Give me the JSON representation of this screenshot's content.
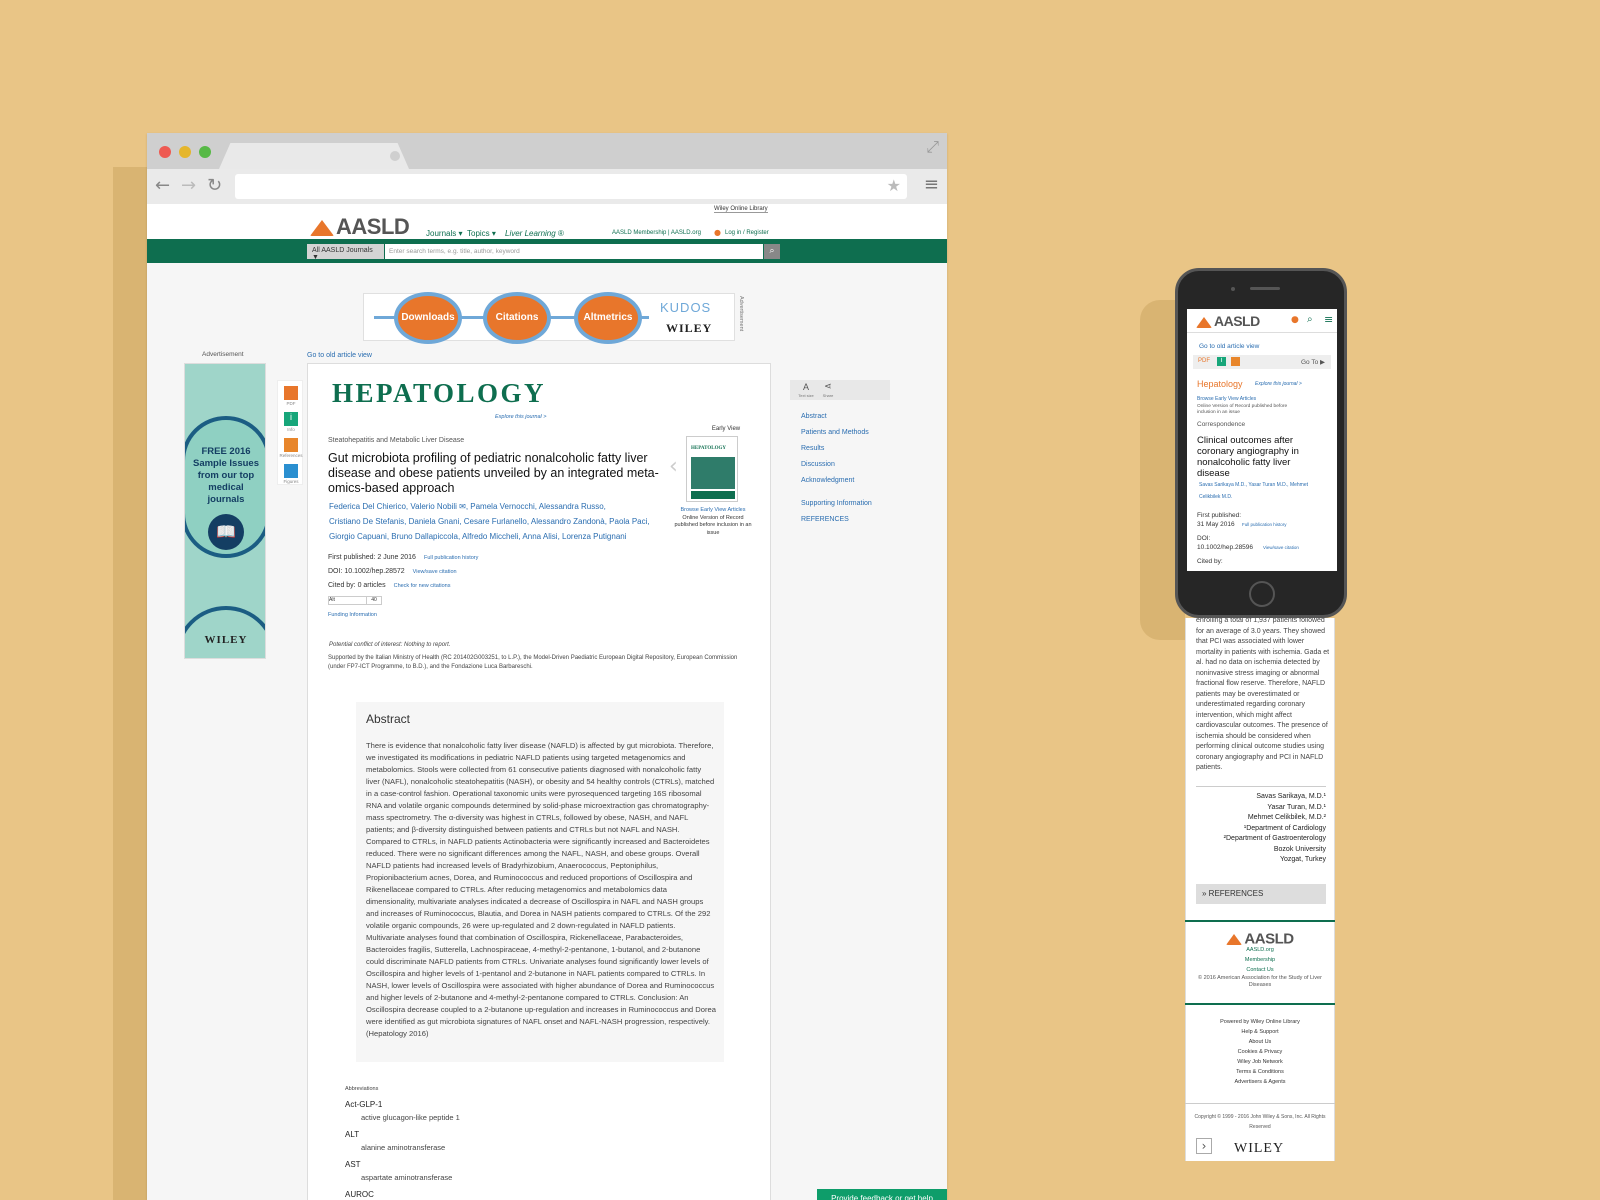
{
  "browser": {
    "url": ""
  },
  "site": {
    "logo": "AASLD",
    "nav": {
      "journals": "Journals ▾",
      "topics": "Topics ▾",
      "liver_learning": "Liver Learning ®"
    },
    "wiley_online_library": "Wiley Online Library",
    "top_links": "AASLD Membership | AASLD.org",
    "login": "Log in / Register",
    "select": "All AASLD Journals ▼",
    "search_placeholder": "Enter search terms, e.g. title, author, keyword"
  },
  "banner": {
    "downloads": "Downloads",
    "citations": "Citations",
    "altmetrics": "Altmetrics",
    "kudos": "KUDOS",
    "wiley": "WILEY",
    "advert": "Advertisement"
  },
  "left_ad": {
    "label": "Advertisement",
    "text": "FREE 2016 Sample Issues from our top medical journals",
    "wiley": "WILEY"
  },
  "article": {
    "old_view": "Go to old article view",
    "journal": "HEPATOLOGY",
    "explore": "Explore this journal >",
    "section": "Steatohepatitis and Metabolic Liver Disease",
    "title": "Gut microbiota profiling of pediatric nonalcoholic fatty liver disease and obese patients unveiled by an integrated meta-omics-based approach",
    "authors_1": "Federica Del Chierico,  Valerio Nobili ✉,  Pamela Vernocchi,  Alessandra Russo,",
    "authors_2": "Cristiano De Stefanis,  Daniela Gnani,  Cesare Furlanello,  Alessandro Zandonà,  Paola Paci,",
    "authors_3": "Giorgio Capuani,  Bruno Dallapiccola,  Alfredo Miccheli,  Anna Alisi,  Lorenza Putignani",
    "first_published": "First published:   2 June 2016",
    "first_published_link": "Full publication history",
    "doi": "DOI:   10.1002/hep.28572",
    "doi_link": "View/save citation",
    "cited_by": "Cited by:   0 articles",
    "cited_link": "Check for new citations",
    "altmetric": "Alt",
    "altmetric_score": "40",
    "funding": "Funding Information",
    "conflict": "Potential conflict of interest: Nothing to report.",
    "support": "Supported by the Italian Ministry of Health (RC 201402G003251, to L.P.), the Model-Driven Paediatric European Digital Repository, European Commission (under FP7-ICT Programme, to B.D.), and the Fondazione Luca Barbareschi.",
    "early_view": "Early View",
    "cover_title": "HEPATOLOGY",
    "browse_ev": "Browse Early View Articles",
    "ev_note": "Online Version of Record published before inclusion in an issue",
    "tools": {
      "pdf": "PDF",
      "info": "Info",
      "references": "References",
      "figures": "Figures"
    }
  },
  "abstract": {
    "heading": "Abstract",
    "text": "There is evidence that nonalcoholic fatty liver disease (NAFLD) is affected by gut microbiota. Therefore, we investigated its modifications in pediatric NAFLD patients using targeted metagenomics and metabolomics. Stools were collected from 61 consecutive patients diagnosed with nonalcoholic fatty liver (NAFL), nonalcoholic steatohepatitis (NASH), or obesity and 54 healthy controls (CTRLs), matched in a case-control fashion. Operational taxonomic units were pyrosequenced targeting 16S ribosomal RNA and volatile organic compounds determined by solid-phase microextraction gas chromatography-mass spectrometry. The α-diversity was highest in CTRLs, followed by obese, NASH, and NAFL patients; and β-diversity distinguished between patients and CTRLs but not NAFL and NASH. Compared to CTRLs, in NAFLD patients Actinobacteria were significantly increased and Bacteroidetes reduced. There were no significant differences among the NAFL, NASH, and obese groups. Overall NAFLD patients had increased levels of Bradyrhizobium, Anaerococcus, Peptoniphilus, Propionibacterium acnes, Dorea, and Ruminococcus and reduced proportions of Oscillospira and Rikenellaceae compared to CTRLs. After reducing metagenomics and metabolomics data dimensionality, multivariate analyses indicated a decrease of Oscillospira in NAFL and NASH groups and increases of Ruminococcus, Blautia, and Dorea in NASH patients compared to CTRLs. Of the 292 volatile organic compounds, 26 were up-regulated and 2 down-regulated in NAFLD patients. Multivariate analyses found that combination of Oscillospira, Rickenellaceae, Parabacteroides, Bacteroides fragilis, Sutterella, Lachnospiraceae, 4-methyl-2-pentanone, 1-butanol, and 2-butanone could discriminate NAFLD patients from CTRLs. Univariate analyses found significantly lower levels of Oscillospira and higher levels of 1-pentanol and 2-butanone in NAFL patients compared to CTRLs. In NASH, lower levels of Oscillospira were associated with higher abundance of Dorea and Ruminococcus and higher levels of 2-butanone and 4-methyl-2-pentanone compared to CTRLs. Conclusion: An Oscillospira decrease coupled to a 2-butanone up-regulation and increases in Ruminococcus and Dorea were identified as gut microbiota signatures of NAFL onset and NAFL-NASH progression, respectively. (Hepatology 2016)"
  },
  "abbreviations": {
    "label": "Abbreviations",
    "items": [
      {
        "term": "Act-GLP-1",
        "def": "active glucagon-like peptide 1"
      },
      {
        "term": "ALT",
        "def": "alanine aminotransferase"
      },
      {
        "term": "AST",
        "def": "aspartate aminotransferase"
      },
      {
        "term": "AUROC",
        "def": ""
      }
    ]
  },
  "right_tools": {
    "text_size": "Text size",
    "share": "Share"
  },
  "toc": [
    "Abstract",
    "Patients and Methods",
    "Results",
    "Discussion",
    "Acknowledgment",
    "Supporting Information",
    "REFERENCES"
  ],
  "feedback": "Provide feedback or get help",
  "phone": {
    "logo": "AASLD",
    "old_view": "Go to old article view",
    "pdf": "PDF",
    "goto": "Go To ▶",
    "journal": "Hepatology",
    "explore": "Explore this journal >",
    "browse_ev": "Browse Early View Articles",
    "ev_note": "Online Version of Record published before inclusion in an issue",
    "section": "Correspondence",
    "title": "Clinical outcomes after coronary angiography in nonalcoholic fatty liver disease",
    "authors": "Savas Sarikaya M.D.,  Yasar Turan M.D.,  Mehmet Celikbilek M.D.",
    "first_published_label": "First published:",
    "first_published": "31 May 2016",
    "fp_link": "Full publication history",
    "doi_label": "DOI:",
    "doi": "10.1002/hep.28596",
    "doi_link": "View/save citation",
    "cited_by": "Cited by:",
    "body": "enrolling a total of 1,937 patients followed for an average of 3.0 years. They showed that PCI was associated with lower mortality in patients with ischemia. Gada et al. had no data on ischemia detected by noninvasive stress imaging or abnormal fractional flow reserve. Therefore, NAFLD patients may be overestimated or underestimated regarding coronary intervention, which might affect cardiovascular outcomes. The presence of ischemia should be considered when performing clinical outcome studies using coronary angiography and PCI in NAFLD patients.",
    "sig": [
      "Savas Sarikaya, M.D.¹",
      "Yasar Turan, M.D.¹",
      "Mehmet Celikbilek, M.D.²",
      "¹Department of Cardiology",
      "²Department of Gastroenterology",
      "Bozok University",
      "Yozgat, Turkey"
    ],
    "references": "»  REFERENCES",
    "footer_logo": "AASLD",
    "footer_links": [
      "AASLD.org",
      "Membership",
      "Contact Us"
    ],
    "footer_copy": "© 2016 American Association for the Study of Liver Diseases",
    "wol_links": [
      "Powered by Wiley Online Library",
      "Help & Support",
      "About Us",
      "Cookies & Privacy",
      "Wiley Job Network",
      "Terms & Conditions",
      "Advertisers & Agents"
    ],
    "copyright": "Copyright © 1999 - 2016 John Wiley & Sons, Inc. All Rights Reserved",
    "wiley": "WILEY"
  }
}
